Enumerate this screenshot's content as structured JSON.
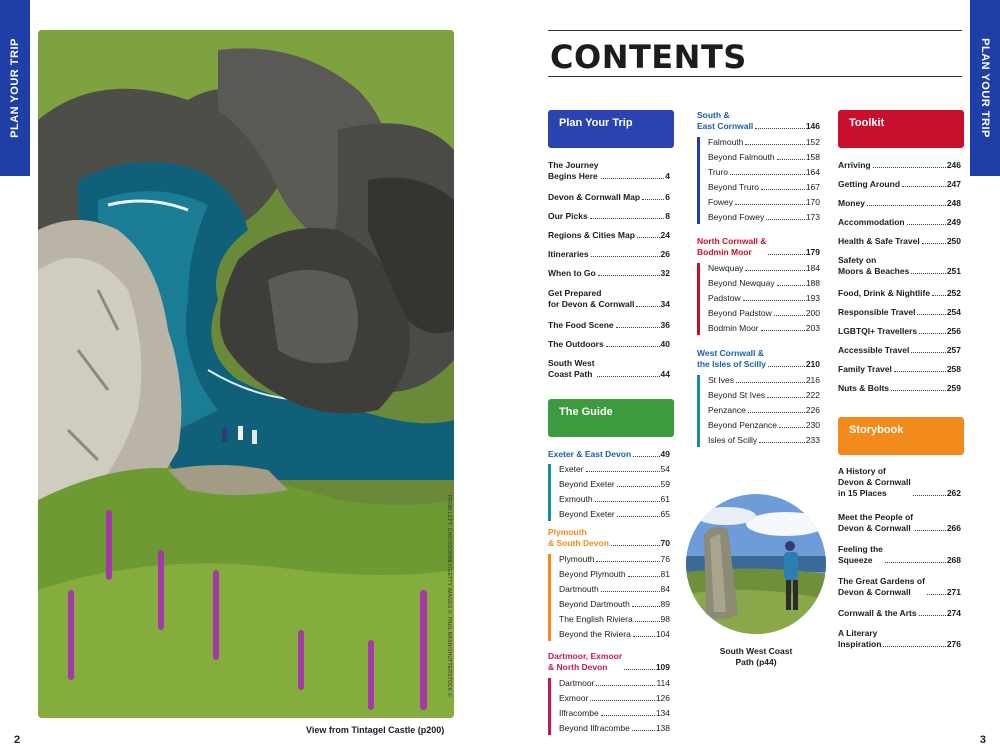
{
  "side_tabs": {
    "left": "PLAN YOUR TRIP",
    "right": "PLAN YOUR TRIP"
  },
  "page_numbers": {
    "left": "2",
    "right": "3"
  },
  "photo": {
    "caption": "View from Tintagel Castle (p200)",
    "credit": "FROM LEFT: CHRISDORNEY/GETTY IMAGES ©, PAUL NASH/SHUTTERSTOCK ©"
  },
  "title": "CONTENTS",
  "colors": {
    "blue": "#2a43b0",
    "green": "#3d9b3f",
    "orange": "#f28a1c",
    "red": "#c8102e",
    "teal": "#1a8aa1",
    "magenta": "#c2185b",
    "navy": "#1f3fa6"
  },
  "sections": {
    "plan": {
      "label": "Plan Your Trip"
    },
    "guide": {
      "label": "The Guide"
    },
    "toolkit": {
      "label": "Toolkit"
    },
    "storybook": {
      "label": "Storybook"
    }
  },
  "plan_items": [
    {
      "t": "The Journey\nBegins Here",
      "p": "4"
    },
    {
      "t": "Devon & Cornwall Map",
      "p": "6"
    },
    {
      "t": "Our Picks",
      "p": "8"
    },
    {
      "t": "Regions & Cities Map",
      "p": "24"
    },
    {
      "t": "Itineraries",
      "p": "26"
    },
    {
      "t": "When to Go",
      "p": "32"
    },
    {
      "t": "Get Prepared\nfor Devon & Cornwall",
      "p": "34"
    },
    {
      "t": "The Food Scene",
      "p": "36"
    },
    {
      "t": "The Outdoors",
      "p": "40"
    },
    {
      "t": "South West\nCoast Path",
      "p": "44"
    }
  ],
  "guide_regions": [
    {
      "name": "Exeter & East Devon",
      "p": "49",
      "items": [
        {
          "t": "Exeter",
          "p": "54"
        },
        {
          "t": "Beyond Exeter",
          "p": "59"
        },
        {
          "t": "Exmouth",
          "p": "61"
        },
        {
          "t": "Beyond Exeter",
          "p": "65"
        }
      ]
    },
    {
      "name": "Plymouth\n& South Devon",
      "p": "70",
      "items": [
        {
          "t": "Plymouth",
          "p": "76"
        },
        {
          "t": "Beyond Plymouth",
          "p": "81"
        },
        {
          "t": "Dartmouth",
          "p": "84"
        },
        {
          "t": "Beyond Dartmouth",
          "p": "89"
        },
        {
          "t": "The English Riviera",
          "p": "98"
        },
        {
          "t": "Beyond the Riviera",
          "p": "104"
        }
      ]
    },
    {
      "name": "Dartmoor, Exmoor\n& North Devon",
      "p": "109",
      "items": [
        {
          "t": "Dartmoor",
          "p": "114"
        },
        {
          "t": "Exmoor",
          "p": "126"
        },
        {
          "t": "Ilfracombe",
          "p": "134"
        },
        {
          "t": "Beyond Ilfracombe",
          "p": "138"
        }
      ]
    },
    {
      "name": "South &\nEast Cornwall",
      "p": "146",
      "items": [
        {
          "t": "Falmouth",
          "p": "152"
        },
        {
          "t": "Beyond Falmouth",
          "p": "158"
        },
        {
          "t": "Truro",
          "p": "164"
        },
        {
          "t": "Beyond Truro",
          "p": "167"
        },
        {
          "t": "Fowey",
          "p": "170"
        },
        {
          "t": "Beyond Fowey",
          "p": "173"
        }
      ]
    },
    {
      "name": "North Cornwall &\nBodmin Moor",
      "p": "179",
      "items": [
        {
          "t": "Newquay",
          "p": "184"
        },
        {
          "t": "Beyond Newquay",
          "p": "188"
        },
        {
          "t": "Padstow",
          "p": "193"
        },
        {
          "t": "Beyond Padstow",
          "p": "200"
        },
        {
          "t": "Bodmin Moor",
          "p": "203"
        }
      ]
    },
    {
      "name": "West Cornwall &\nthe Isles of Scilly",
      "p": "210",
      "items": [
        {
          "t": "St Ives",
          "p": "216"
        },
        {
          "t": "Beyond St Ives",
          "p": "222"
        },
        {
          "t": "Penzance",
          "p": "226"
        },
        {
          "t": "Beyond Penzance",
          "p": "230"
        },
        {
          "t": "Isles of Scilly",
          "p": "233"
        }
      ]
    }
  ],
  "toolkit_items": [
    {
      "t": "Arriving",
      "p": "246"
    },
    {
      "t": "Getting Around",
      "p": "247"
    },
    {
      "t": "Money",
      "p": "248"
    },
    {
      "t": "Accommodation",
      "p": "249"
    },
    {
      "t": "Health & Safe Travel",
      "p": "250"
    },
    {
      "t": "Safety on\nMoors & Beaches",
      "p": "251"
    },
    {
      "t": "Food, Drink & Nightlife",
      "p": "252"
    },
    {
      "t": "Responsible Travel",
      "p": "254"
    },
    {
      "t": "LGBTQI+ Travellers",
      "p": "256"
    },
    {
      "t": "Accessible Travel",
      "p": "257"
    },
    {
      "t": "Family Travel",
      "p": "258"
    },
    {
      "t": "Nuts & Bolts",
      "p": "259"
    }
  ],
  "storybook_items": [
    {
      "t": "A History of\nDevon & Cornwall\nin 15 Places",
      "p": "262"
    },
    {
      "t": "Meet the People of\nDevon & Cornwall",
      "p": "266"
    },
    {
      "t": "Feeling the\nSqueeze",
      "p": "268"
    },
    {
      "t": "The Great Gardens of\nDevon & Cornwall",
      "p": "271"
    },
    {
      "t": "Cornwall & the Arts",
      "p": "274"
    },
    {
      "t": "A Literary\nInspiration",
      "p": "276"
    }
  ],
  "circle_caption": "South West Coast\nPath (p44)"
}
